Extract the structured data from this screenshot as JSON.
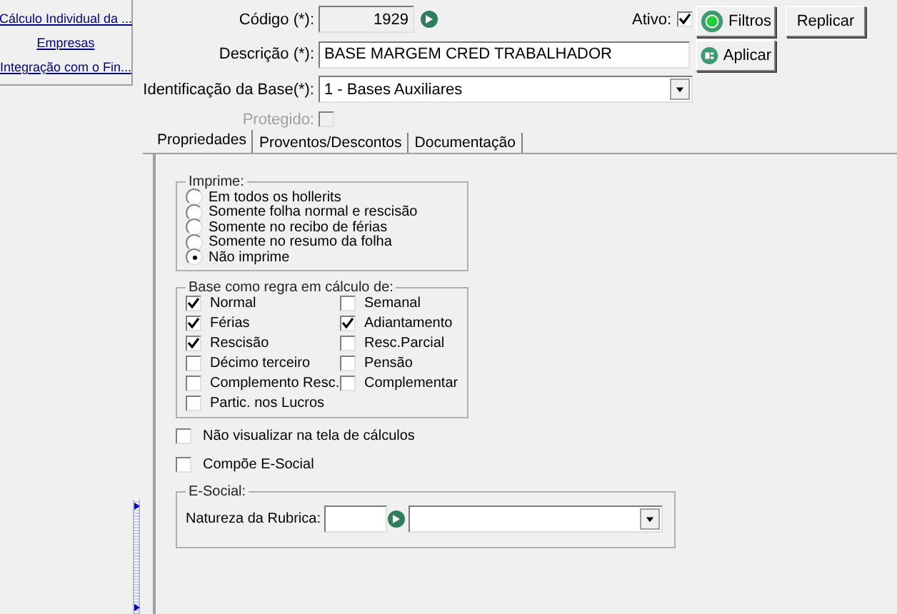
{
  "sidebar": {
    "links": [
      "Cálculo Individual da ...",
      "Empresas",
      "Integração com o Fin..."
    ]
  },
  "form": {
    "codigo_label": "Código (*):",
    "codigo": "1929",
    "ativo_label": "Ativo:",
    "ativo_checked": true,
    "descricao_label": "Descrição (*):",
    "descricao": "BASE MARGEM CRED TRABALHADOR",
    "identificacao_label": "Identificação da Base(*):",
    "identificacao": "1 - Bases Auxiliares",
    "protegido_label": "Protegido:",
    "protegido_checked": false,
    "protegido_disabled": true
  },
  "buttons": [
    {
      "label": "Filtros",
      "kind": "filter"
    },
    {
      "label": "Aplicar",
      "kind": "apply"
    },
    {
      "label": "Replicar",
      "kind": "plain"
    }
  ],
  "tabs": [
    {
      "label": "Propriedades",
      "selected": true
    },
    {
      "label": "Proventos/Descontos",
      "selected": false
    },
    {
      "label": "Documentação",
      "selected": false
    }
  ],
  "imprime": {
    "title": "Imprime:",
    "options": [
      {
        "label": "Em todos os hollerits",
        "selected": false
      },
      {
        "label": "Somente folha normal e rescisão",
        "selected": false
      },
      {
        "label": "Somente no recibo de férias",
        "selected": false
      },
      {
        "label": "Somente no resumo da folha",
        "selected": false
      },
      {
        "label": "Não imprime",
        "selected": true
      }
    ]
  },
  "base": {
    "title": "Base como regra em cálculo de:",
    "items": [
      {
        "label": "Normal",
        "checked": true
      },
      {
        "label": "Semanal",
        "checked": false
      },
      {
        "label": "Férias",
        "checked": true
      },
      {
        "label": "Adiantamento",
        "checked": true
      },
      {
        "label": "Rescisão",
        "checked": true
      },
      {
        "label": "Resc.Parcial",
        "checked": false
      },
      {
        "label": "Décimo terceiro",
        "checked": false
      },
      {
        "label": "Pensão",
        "checked": false
      },
      {
        "label": "Complemento Resc.",
        "checked": false
      },
      {
        "label": "Complementar",
        "checked": false
      },
      {
        "label": "Partic. nos Lucros",
        "checked": false
      }
    ]
  },
  "options": [
    {
      "label": "Não visualizar na tela de cálculos",
      "checked": false
    },
    {
      "label": "Compõe E-Social",
      "checked": false
    }
  ],
  "esocial": {
    "title": "E-Social:",
    "natureza_label": "Natureza da Rubrica:"
  }
}
